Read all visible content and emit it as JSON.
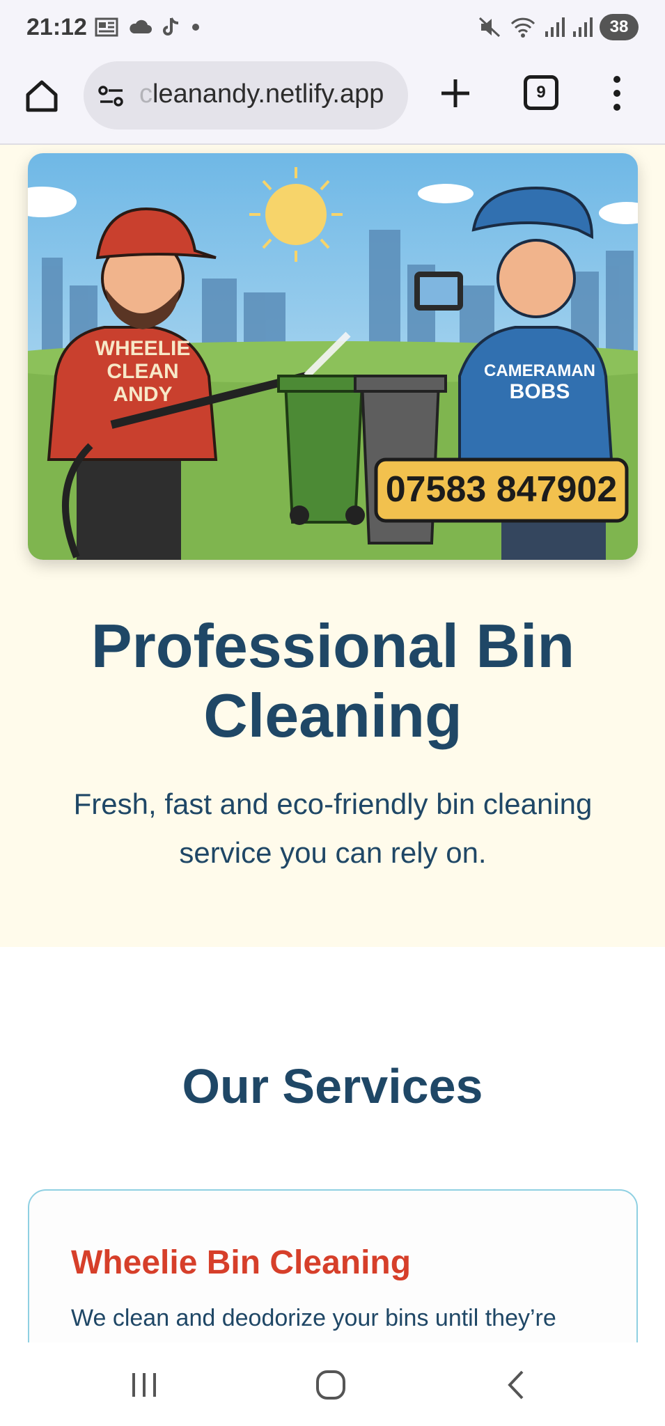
{
  "status_bar": {
    "time": "21:12",
    "battery": "38",
    "left_icons": [
      "news-icon",
      "cloud-icon",
      "tiktok-icon",
      "dot-icon"
    ],
    "right_icons": [
      "mute-icon",
      "wifi-icon",
      "signal-icon",
      "signal-icon"
    ]
  },
  "browser": {
    "url_faded": "c",
    "url": "leanandy.netlify.app",
    "tab_count": "9"
  },
  "hero": {
    "image": {
      "left_person_shirt": [
        "WHEELIE",
        "CLEAN",
        "ANDY"
      ],
      "right_person_shirt": [
        "CAMERAMAN",
        "BOBS"
      ],
      "phone_number": "07583 847902"
    },
    "title": "Professional Bin Cleaning",
    "subtitle": "Fresh, fast and eco-friendly bin cleaning service you can rely on."
  },
  "services": {
    "title": "Our Services",
    "cards": [
      {
        "title": "Wheelie Bin Cleaning",
        "text": "We clean and deodorize your bins until they’re fresh and hygienic."
      }
    ]
  },
  "colors": {
    "hero_bg": "#fffbeb",
    "heading": "#1f4766",
    "accent_red": "#d63f2a",
    "card_border": "#8fd0e2"
  }
}
